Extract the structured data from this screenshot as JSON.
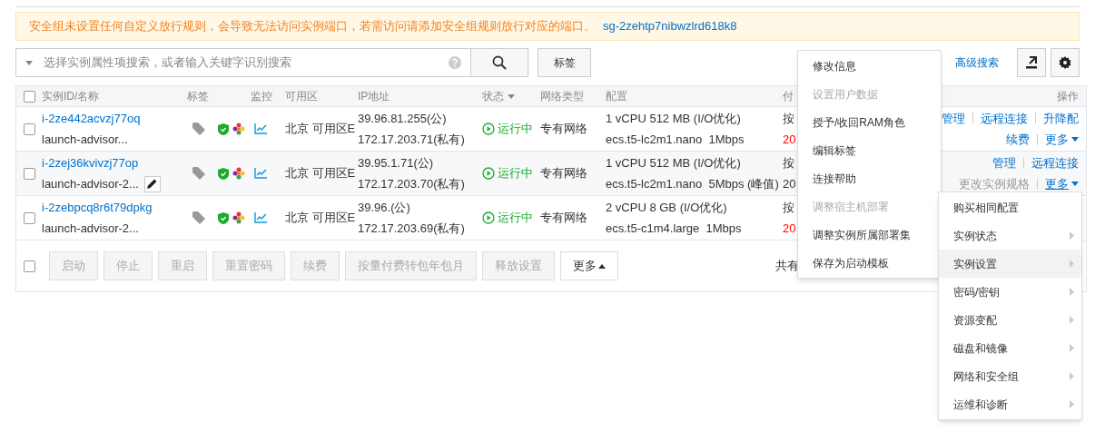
{
  "alert": {
    "message": "安全组未设置任何自定义放行规则，会导致无法访问实例端口，若需访问请添加安全组规则放行对应的端口。",
    "link": "sg-2zehtp7nibwzlrd618k8"
  },
  "search": {
    "placeholder": "选择实例属性项搜索，或者输入关键字识别搜索"
  },
  "tag_button": "标签",
  "advanced_search": "高级搜索",
  "table": {
    "header_checked": false,
    "columns": [
      {
        "label": "实例ID/名称",
        "kind": "plain"
      },
      {
        "label": "标签",
        "kind": "plain"
      },
      {
        "label": "监控",
        "kind": "plain"
      },
      {
        "label": "可用区",
        "kind": "plain"
      },
      {
        "label": "IP地址",
        "kind": "plain"
      },
      {
        "label": "状态",
        "kind": "filter"
      },
      {
        "label": "网络类型",
        "kind": "plain"
      },
      {
        "label": "配置",
        "kind": "plain"
      },
      {
        "label": "付",
        "kind": "plain"
      },
      {
        "label": "操作",
        "kind": "plain"
      }
    ],
    "rows": [
      {
        "checked": false,
        "hovered": false,
        "id": "i-2ze442acvzj77oq",
        "name": "launch-advisor...",
        "zone": "北京 可用区E",
        "ip_public": "39.96.81.255(公)",
        "ip_private": "172.17.203.71(私有)",
        "status": "运行中",
        "network": "专有网络",
        "config": "1 vCPU 512 MB (I/O优化)",
        "spec": "ecs.t5-lc2m1.nano  1Mbps",
        "pay": "按",
        "expire": "20",
        "expiring": true,
        "action_lines": [
          {
            "items": [
              {
                "label": "管理",
                "disabled": false,
                "kind": "link"
              },
              {
                "label": "远程连接",
                "disabled": false,
                "kind": "link"
              },
              {
                "label": "升降配",
                "disabled": false,
                "kind": "link"
              }
            ]
          },
          {
            "items": [
              {
                "label": "续费",
                "disabled": false,
                "kind": "link"
              },
              {
                "label": "更多",
                "disabled": false,
                "kind": "dropdown"
              }
            ]
          }
        ]
      },
      {
        "checked": false,
        "hovered": true,
        "id": "i-2zej36kvivzj77op",
        "name": "launch-advisor-2...",
        "zone": "北京 可用区E",
        "ip_public": "39.95.1.71(公)",
        "ip_private": "172.17.203.70(私有)",
        "status": "运行中",
        "network": "专有网络",
        "config": "1 vCPU 512 MB (I/O优化)",
        "spec": "ecs.t5-lc2m1.nano  5Mbps (峰值)",
        "pay": "按",
        "expire": "20",
        "expiring": false,
        "action_lines": [
          {
            "items": [
              {
                "label": "管理",
                "disabled": false,
                "kind": "link"
              },
              {
                "label": "远程连接",
                "disabled": false,
                "kind": "link"
              }
            ]
          },
          {
            "items": [
              {
                "label": "更改实例规格",
                "disabled": true,
                "kind": "link"
              },
              {
                "label": "更多",
                "disabled": false,
                "kind": "dropdown"
              }
            ]
          }
        ]
      },
      {
        "checked": false,
        "hovered": false,
        "id": "i-2zebpcq8r6t79dpkg",
        "name": "launch-advisor-2...",
        "zone": "北京 可用区E",
        "ip_public": "39.96.(公)",
        "ip_private": "172.17.203.69(私有)",
        "status": "运行中",
        "network": "专有网络",
        "config": "2 vCPU 8 GB (I/O优化)",
        "spec": "ecs.t5-c1m4.large  1Mbps",
        "pay": "按",
        "expire": "20",
        "expiring": true,
        "action_lines": []
      }
    ]
  },
  "footer": {
    "checked": false,
    "buttons": [
      {
        "label": "启动",
        "disabled": true,
        "kind": "button"
      },
      {
        "label": "停止",
        "disabled": true,
        "kind": "button"
      },
      {
        "label": "重启",
        "disabled": true,
        "kind": "button"
      },
      {
        "label": "重置密码",
        "disabled": true,
        "kind": "button"
      },
      {
        "label": "续费",
        "disabled": true,
        "kind": "button"
      },
      {
        "label": "按量付费转包年包月",
        "disabled": true,
        "kind": "button"
      },
      {
        "label": "释放设置",
        "disabled": true,
        "kind": "button"
      },
      {
        "label": "更多",
        "disabled": false,
        "kind": "dropup"
      }
    ],
    "total": "共有"
  },
  "more_menu": {
    "items": [
      {
        "label": "修改信息",
        "disabled": false
      },
      {
        "label": "设置用户数据",
        "disabled": true
      },
      {
        "label": "授予/收回RAM角色",
        "disabled": false
      },
      {
        "label": "编辑标签",
        "disabled": false
      },
      {
        "label": "连接帮助",
        "disabled": false
      },
      {
        "label": "调整宿主机部署",
        "disabled": true
      },
      {
        "label": "调整实例所属部署集",
        "disabled": false
      },
      {
        "label": "保存为启动模板",
        "disabled": false
      }
    ]
  },
  "action_menu": {
    "items": [
      {
        "label": "购买相同配置",
        "submenu": false,
        "selected": false
      },
      {
        "label": "实例状态",
        "submenu": true,
        "selected": false
      },
      {
        "label": "实例设置",
        "submenu": true,
        "selected": true
      },
      {
        "label": "密码/密钥",
        "submenu": true,
        "selected": false
      },
      {
        "label": "资源变配",
        "submenu": true,
        "selected": false
      },
      {
        "label": "磁盘和镜像",
        "submenu": true,
        "selected": false
      },
      {
        "label": "网络和安全组",
        "submenu": true,
        "selected": false
      },
      {
        "label": "运维和诊断",
        "submenu": true,
        "selected": false
      }
    ]
  }
}
